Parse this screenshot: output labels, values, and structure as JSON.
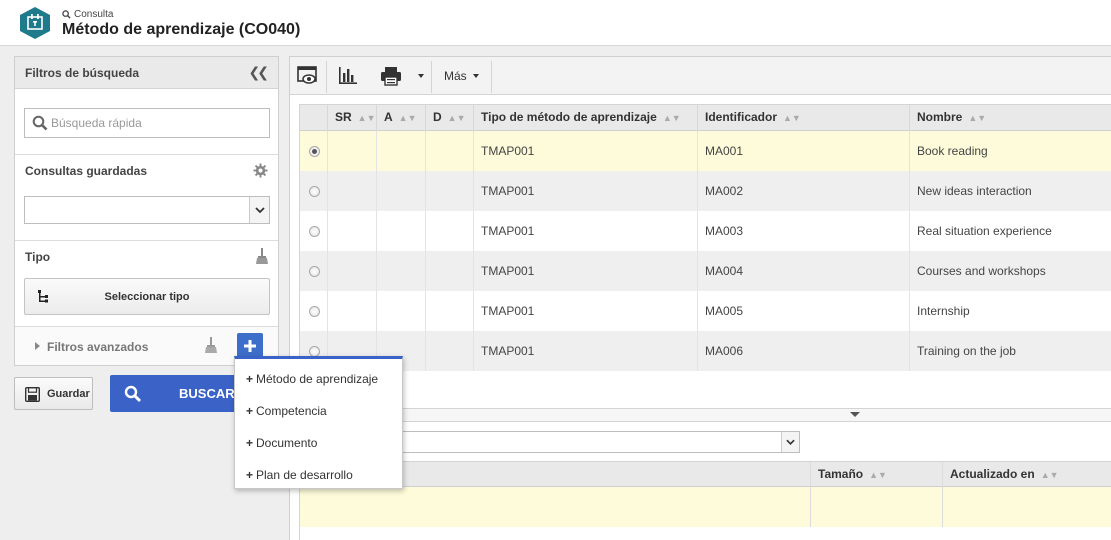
{
  "header": {
    "breadcrumb": "Consulta",
    "title": "Método de aprendizaje (CO040)",
    "accent_color": "#1f7a8c"
  },
  "filters": {
    "title": "Filtros de búsqueda",
    "collapse_icon": "double-chevron-left-icon",
    "search_placeholder": "Búsqueda rápida",
    "saved_queries_label": "Consultas guardadas",
    "saved_queries_value": "",
    "type_label": "Tipo",
    "select_type_label": "Seleccionar tipo",
    "advanced_label": "Filtros avanzados",
    "save_label": "Guardar",
    "search_button_label": "BUSCAR",
    "search_button_color": "#3a62c7"
  },
  "toolbar": {
    "more_label": "Más"
  },
  "grid": {
    "columns": [
      "SR",
      "A",
      "D",
      "Tipo de método de aprendizaje",
      "Identificador",
      "Nombre"
    ],
    "rows": [
      {
        "type": "TMAP001",
        "id": "MA001",
        "name": "Book reading",
        "selected": true
      },
      {
        "type": "TMAP001",
        "id": "MA002",
        "name": "New ideas interaction",
        "selected": false
      },
      {
        "type": "TMAP001",
        "id": "MA003",
        "name": "Real situation experience",
        "selected": false
      },
      {
        "type": "TMAP001",
        "id": "MA004",
        "name": "Courses and workshops",
        "selected": false
      },
      {
        "type": "TMAP001",
        "id": "MA005",
        "name": "Internship",
        "selected": false
      },
      {
        "type": "TMAP001",
        "id": "MA006",
        "name": "Training on the job",
        "selected": false
      }
    ],
    "selected_row_color": "#fdfbd9"
  },
  "lower_grid": {
    "select_value": "",
    "columns": [
      "Tamaño",
      "Actualizado en"
    ]
  },
  "add_menu": {
    "items": [
      "Método de aprendizaje",
      "Competencia",
      "Documento",
      "Plan de desarrollo"
    ]
  }
}
